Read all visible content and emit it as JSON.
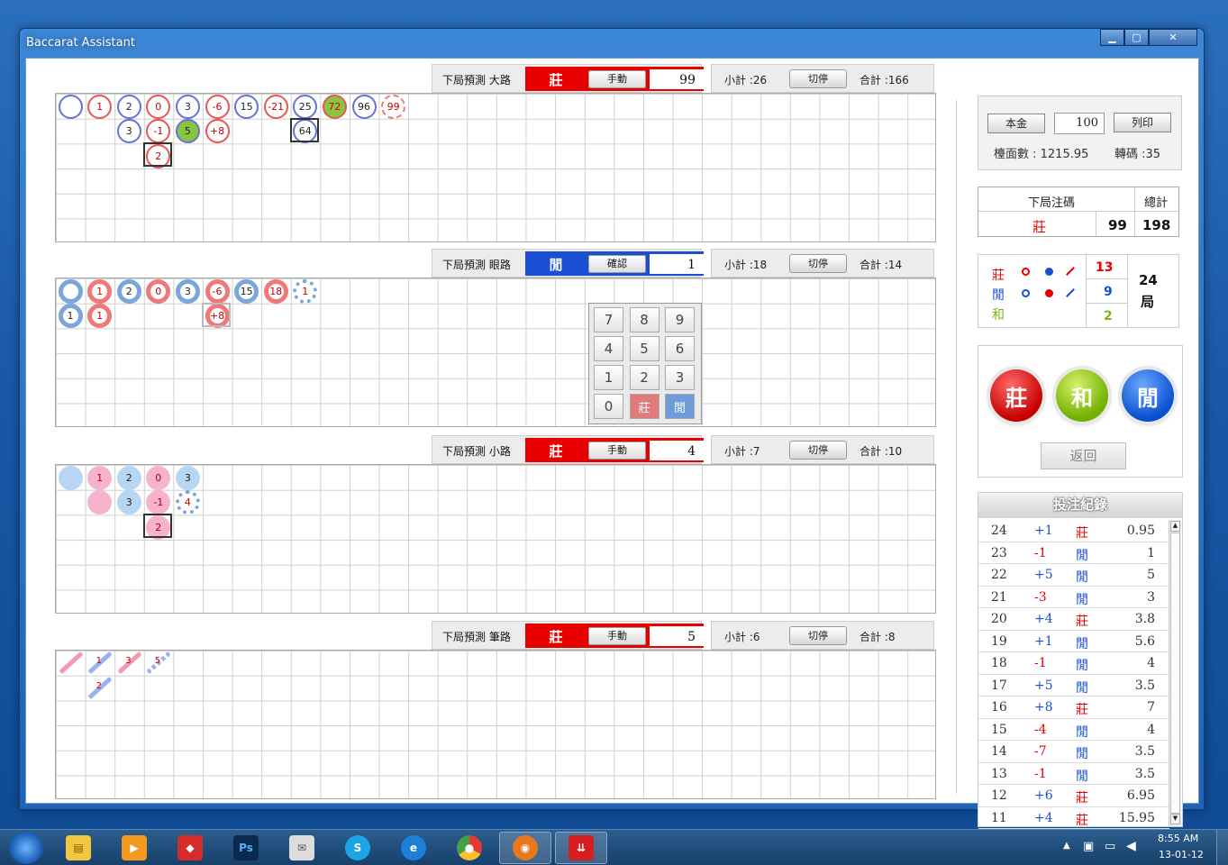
{
  "window": {
    "title": "Baccarat Assistant",
    "btn_min": "▁",
    "btn_max": "▢",
    "btn_close": "✕"
  },
  "sections": [
    {
      "label": "下局預測  大路",
      "pred": "莊",
      "mode": "手動",
      "num": "99",
      "sub": "小計 :26",
      "stop": "切停",
      "total": "合計 :166"
    },
    {
      "label": "下局預測  眼路",
      "pred": "閒",
      "mode": "確認",
      "num": "1",
      "sub": "小計 :18",
      "stop": "切停",
      "total": "合計 :14"
    },
    {
      "label": "下局預測  小路",
      "pred": "莊",
      "mode": "手動",
      "num": "4",
      "sub": "小計 :7",
      "stop": "切停",
      "total": "合計 :10"
    },
    {
      "label": "下局預測  筆路",
      "pred": "莊",
      "mode": "手動",
      "num": "5",
      "sub": "小計 :6",
      "stop": "切停",
      "total": "合計 :8"
    }
  ],
  "grid1": [
    {
      "c": 0,
      "r": 0,
      "t": "b",
      "v": ""
    },
    {
      "c": 1,
      "r": 0,
      "t": "r",
      "v": "1"
    },
    {
      "c": 2,
      "r": 0,
      "t": "b",
      "v": "2"
    },
    {
      "c": 3,
      "r": 0,
      "t": "r",
      "v": "0"
    },
    {
      "c": 4,
      "r": 0,
      "t": "b",
      "v": "3"
    },
    {
      "c": 5,
      "r": 0,
      "t": "r",
      "v": "-6"
    },
    {
      "c": 6,
      "r": 0,
      "t": "b",
      "v": "15"
    },
    {
      "c": 7,
      "r": 0,
      "t": "r",
      "v": "-21"
    },
    {
      "c": 8,
      "r": 0,
      "t": "b",
      "v": "25"
    },
    {
      "c": 9,
      "r": 0,
      "t": "r green",
      "v": "72"
    },
    {
      "c": 10,
      "r": 0,
      "t": "b",
      "v": "96"
    },
    {
      "c": 11,
      "r": 0,
      "t": "dash",
      "v": "99"
    },
    {
      "c": 2,
      "r": 1,
      "t": "b",
      "v": "3"
    },
    {
      "c": 3,
      "r": 1,
      "t": "r",
      "v": "-1"
    },
    {
      "c": 4,
      "r": 1,
      "t": "b green",
      "v": "5"
    },
    {
      "c": 5,
      "r": 1,
      "t": "r",
      "v": "+8"
    },
    {
      "c": 8,
      "r": 1,
      "t": "b",
      "v": "64"
    },
    {
      "c": 3,
      "r": 2,
      "t": "r",
      "v": "2"
    }
  ],
  "grid2": [
    {
      "c": 0,
      "r": 0,
      "t": "bt",
      "v": ""
    },
    {
      "c": 1,
      "r": 0,
      "t": "rt",
      "v": "1"
    },
    {
      "c": 2,
      "r": 0,
      "t": "bt",
      "v": "2"
    },
    {
      "c": 3,
      "r": 0,
      "t": "rt",
      "v": "0"
    },
    {
      "c": 4,
      "r": 0,
      "t": "bt",
      "v": "3"
    },
    {
      "c": 5,
      "r": 0,
      "t": "rt",
      "v": "-6"
    },
    {
      "c": 6,
      "r": 0,
      "t": "bt",
      "v": "15"
    },
    {
      "c": 7,
      "r": 0,
      "t": "rt",
      "v": "18"
    },
    {
      "c": 8,
      "r": 0,
      "t": "dashb",
      "v": "1"
    },
    {
      "c": 0,
      "r": 1,
      "t": "bt",
      "v": "1"
    },
    {
      "c": 1,
      "r": 1,
      "t": "rt",
      "v": "1"
    },
    {
      "c": 5,
      "r": 1,
      "t": "rt",
      "v": "+8"
    }
  ],
  "grid3": [
    {
      "c": 0,
      "r": 0,
      "t": "bf",
      "v": ""
    },
    {
      "c": 1,
      "r": 0,
      "t": "rf",
      "v": "1"
    },
    {
      "c": 2,
      "r": 0,
      "t": "bf",
      "v": "2"
    },
    {
      "c": 3,
      "r": 0,
      "t": "rf",
      "v": "0"
    },
    {
      "c": 4,
      "r": 0,
      "t": "bf",
      "v": "3"
    },
    {
      "c": 1,
      "r": 1,
      "t": "rf",
      "v": ""
    },
    {
      "c": 2,
      "r": 1,
      "t": "bf",
      "v": "3"
    },
    {
      "c": 3,
      "r": 1,
      "t": "rf",
      "v": "-1"
    },
    {
      "c": 4,
      "r": 1,
      "t": "dashb",
      "v": "4"
    },
    {
      "c": 3,
      "r": 2,
      "t": "rf",
      "v": "2"
    }
  ],
  "grid4": [
    {
      "c": 0,
      "r": 0,
      "t": "r",
      "v": ""
    },
    {
      "c": 1,
      "r": 0,
      "t": "b",
      "v": "1"
    },
    {
      "c": 2,
      "r": 0,
      "t": "r",
      "v": "3"
    },
    {
      "c": 3,
      "r": 0,
      "t": "bd",
      "v": "5"
    },
    {
      "c": 1,
      "r": 1,
      "t": "b",
      "v": "2"
    }
  ],
  "keypad": [
    "7",
    "8",
    "9",
    "4",
    "5",
    "6",
    "1",
    "2",
    "3",
    "0",
    "莊",
    "閒"
  ],
  "bank": {
    "principal_btn": "本金",
    "principal": "100",
    "print_btn": "列印",
    "floor_label": "檯面數 : 1215.95",
    "turn_label": "轉碼 :35"
  },
  "next_bet": {
    "header": "下局注碼",
    "total_header": "總計",
    "side": "莊",
    "amount": "99",
    "total": "198"
  },
  "stats": {
    "b_label": "莊",
    "p_label": "閒",
    "t_label": "和",
    "b_count": "13",
    "p_count": "9",
    "t_count": "2",
    "rounds": "24",
    "rounds_unit": "局"
  },
  "big": {
    "banker": "莊",
    "tie": "和",
    "player": "閒",
    "back": "返回"
  },
  "log": {
    "title": "投注紀錄",
    "rows": [
      {
        "n": "24",
        "d": "+1",
        "s": "莊",
        "v": "0.95"
      },
      {
        "n": "23",
        "d": "-1",
        "s": "閒",
        "v": "1"
      },
      {
        "n": "22",
        "d": "+5",
        "s": "閒",
        "v": "5"
      },
      {
        "n": "21",
        "d": "-3",
        "s": "閒",
        "v": "3"
      },
      {
        "n": "20",
        "d": "+4",
        "s": "莊",
        "v": "3.8"
      },
      {
        "n": "19",
        "d": "+1",
        "s": "閒",
        "v": "5.6"
      },
      {
        "n": "18",
        "d": "-1",
        "s": "閒",
        "v": "4"
      },
      {
        "n": "17",
        "d": "+5",
        "s": "閒",
        "v": "3.5"
      },
      {
        "n": "16",
        "d": "+8",
        "s": "莊",
        "v": "7"
      },
      {
        "n": "15",
        "d": "-4",
        "s": "閒",
        "v": "4"
      },
      {
        "n": "14",
        "d": "-7",
        "s": "閒",
        "v": "3.5"
      },
      {
        "n": "13",
        "d": "-1",
        "s": "閒",
        "v": "3.5"
      },
      {
        "n": "12",
        "d": "+6",
        "s": "莊",
        "v": "6.95"
      },
      {
        "n": "11",
        "d": "+4",
        "s": "莊",
        "v": "15.95"
      }
    ]
  },
  "taskbar": {
    "time": "8:55 AM",
    "date": "13-01-12"
  },
  "colors": {
    "banker": "#e80000",
    "player": "#1a4fd4",
    "tie": "#7cb518"
  }
}
